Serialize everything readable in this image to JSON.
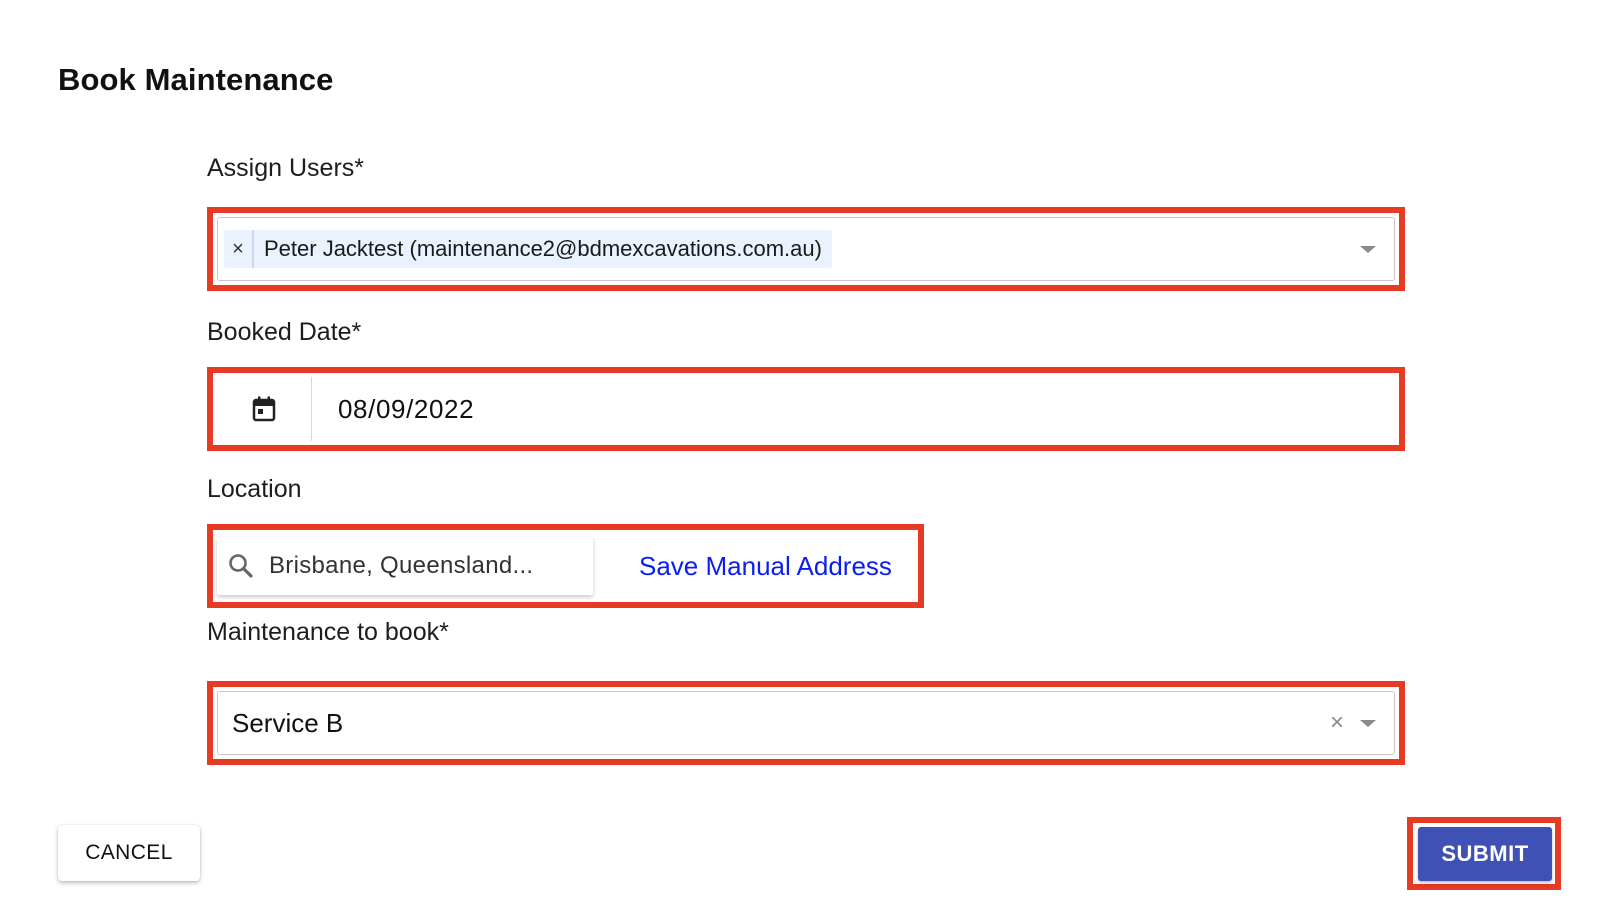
{
  "dialog": {
    "title": "Book Maintenance"
  },
  "assign_users": {
    "label": "Assign Users*",
    "chips": [
      {
        "remove_symbol": "×",
        "text": "Peter Jacktest (maintenance2@bdmexcavations.com.au)"
      }
    ],
    "icon": "chevron-down-icon"
  },
  "booked_date": {
    "label": "Booked Date*",
    "icon": "calendar-icon",
    "value": "08/09/2022"
  },
  "location": {
    "label": "Location",
    "icon": "search-icon",
    "search_value": "Brisbane, Queensland...",
    "save_manual_label": "Save Manual Address"
  },
  "maintenance": {
    "label": "Maintenance to book*",
    "value": "Service B",
    "clear_symbol": "×",
    "icon": "chevron-down-icon"
  },
  "actions": {
    "cancel_label": "CANCEL",
    "submit_label": "SUBMIT"
  },
  "colors": {
    "highlight": "#e63a23",
    "primary": "#3f51b5",
    "link": "#0b1ef0",
    "chip_bg": "#eaf2fd"
  }
}
